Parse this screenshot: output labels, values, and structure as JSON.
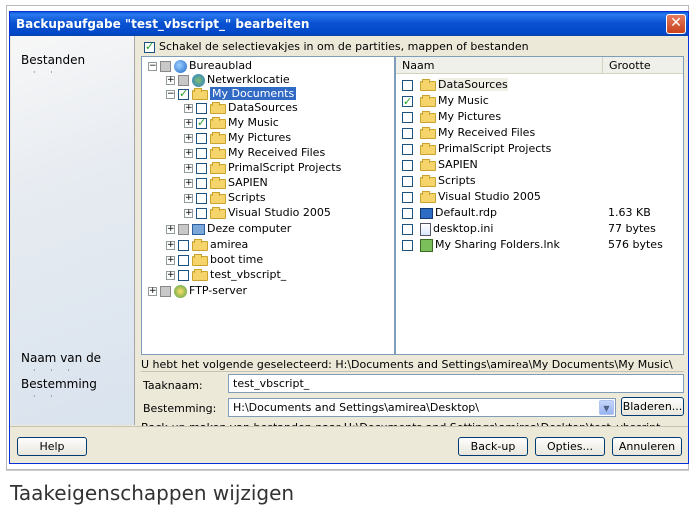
{
  "window": {
    "title": "Backupaufgabe \"test_vbscript_\" bearbeiten",
    "close_label": "✕"
  },
  "left_panel": {
    "label_files": "Bestanden",
    "label_name": "Naam van de",
    "label_destination": "Bestemming"
  },
  "top_check": {
    "label": "Schakel de selectievakjes in om de partities, mappen of bestanden",
    "checked": true
  },
  "tree": {
    "items": [
      {
        "label": "Bureaublad",
        "icon": "desktop-icon",
        "checked": false,
        "partial": true,
        "expanded": true
      },
      {
        "label": "Netwerklocatie",
        "icon": "network-icon",
        "checked": false,
        "partial": true
      },
      {
        "label": "My Documents",
        "icon": "folder-icon",
        "checked": true,
        "selected": true
      },
      {
        "label": "DataSources",
        "icon": "folder-icon",
        "checked": false
      },
      {
        "label": "My Music",
        "icon": "folder-icon",
        "checked": true
      },
      {
        "label": "My Pictures",
        "icon": "folder-icon",
        "checked": false
      },
      {
        "label": "My Received Files",
        "icon": "folder-icon",
        "checked": false
      },
      {
        "label": "PrimalScript Projects",
        "icon": "folder-icon",
        "checked": false
      },
      {
        "label": "SAPIEN",
        "icon": "folder-icon",
        "checked": false
      },
      {
        "label": "Scripts",
        "icon": "folder-icon",
        "checked": false
      },
      {
        "label": "Visual Studio 2005",
        "icon": "folder-icon",
        "checked": false
      },
      {
        "label": "Deze computer",
        "icon": "computer-icon",
        "checked": false,
        "partial": true
      },
      {
        "label": "amirea",
        "icon": "folder-icon",
        "checked": false
      },
      {
        "label": "boot time",
        "icon": "folder-icon",
        "checked": false
      },
      {
        "label": "test_vbscript_",
        "icon": "folder-icon",
        "checked": false
      },
      {
        "label": "FTP-server",
        "icon": "ftp-icon",
        "checked": false,
        "partial": true
      }
    ]
  },
  "file_list": {
    "col_name": "Naam",
    "col_size": "Grootte",
    "rows": [
      {
        "name": "DataSources",
        "size": "",
        "icon": "folder-icon",
        "checked": false
      },
      {
        "name": "My Music",
        "size": "",
        "icon": "folder-icon",
        "checked": true
      },
      {
        "name": "My Pictures",
        "size": "",
        "icon": "folder-icon",
        "checked": false
      },
      {
        "name": "My Received Files",
        "size": "",
        "icon": "folder-icon",
        "checked": false
      },
      {
        "name": "PrimalScript Projects",
        "size": "",
        "icon": "folder-icon",
        "checked": false
      },
      {
        "name": "SAPIEN",
        "size": "",
        "icon": "folder-icon",
        "checked": false
      },
      {
        "name": "Scripts",
        "size": "",
        "icon": "folder-icon",
        "checked": false
      },
      {
        "name": "Visual Studio 2005",
        "size": "",
        "icon": "folder-icon",
        "checked": false
      },
      {
        "name": "Default.rdp",
        "size": "1.63 KB",
        "icon": "rdp-file-icon",
        "checked": false
      },
      {
        "name": "desktop.ini",
        "size": "77 bytes",
        "icon": "ini-file-icon",
        "checked": false
      },
      {
        "name": "My Sharing Folders.lnk",
        "size": "576 bytes",
        "icon": "shortcut-icon",
        "checked": false
      }
    ]
  },
  "status": {
    "selected_text": "U hebt het volgende geselecteerd: H:\\Documents and Settings\\amirea\\My Documents\\My Music\\"
  },
  "task": {
    "name_label": "Taaknaam:",
    "name_value": "test_vbscript_",
    "dest_label": "Bestemming:",
    "dest_value": "H:\\Documents and Settings\\amirea\\Desktop\\",
    "browse_label": "Bladeren...",
    "backup_info": "Back-up maken van bestanden naar H:\\Documents and Settings\\amirea\\Desktop\\test_vbscript_."
  },
  "buttons": {
    "help": "Help",
    "backup": "Back-up",
    "options": "Opties...",
    "cancel": "Annuleren"
  },
  "caption": "Taakeigenschappen wijzigen"
}
